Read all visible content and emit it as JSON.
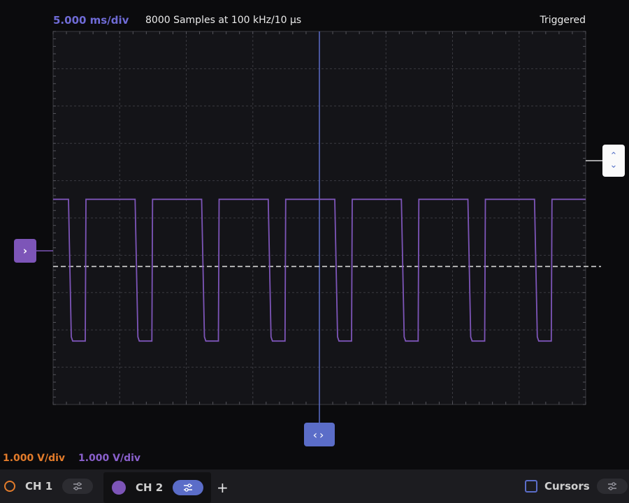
{
  "header": {
    "timebase": "5.000 ms/div",
    "samples": "8000 Samples at 100 kHz/10 µs",
    "status": "Triggered"
  },
  "scale": {
    "ch1_vdiv": "1.000 V/div",
    "ch2_vdiv": "1.000 V/div"
  },
  "colors": {
    "ch1": "#e37c2b",
    "ch2": "#7d55b8",
    "accent": "#5b6dc8",
    "trigger_level": "#d8d8d8"
  },
  "waveform": {
    "channel": "CH 2",
    "shape": "square",
    "period_div": 1.0,
    "high_div": 5.5,
    "low_div": 1.7,
    "trigger_level_div": 3.7
  },
  "controls": {
    "trigger_arrows": {
      "up": "⌃",
      "down": "⌄"
    },
    "ch2_marker": "›",
    "horizontal_pos": "‹›"
  },
  "bottom": {
    "ch1_label": "CH 1",
    "ch2_label": "CH 2",
    "add": "+",
    "cursors_label": "Cursors",
    "settings_icon": "sliders-icon"
  }
}
